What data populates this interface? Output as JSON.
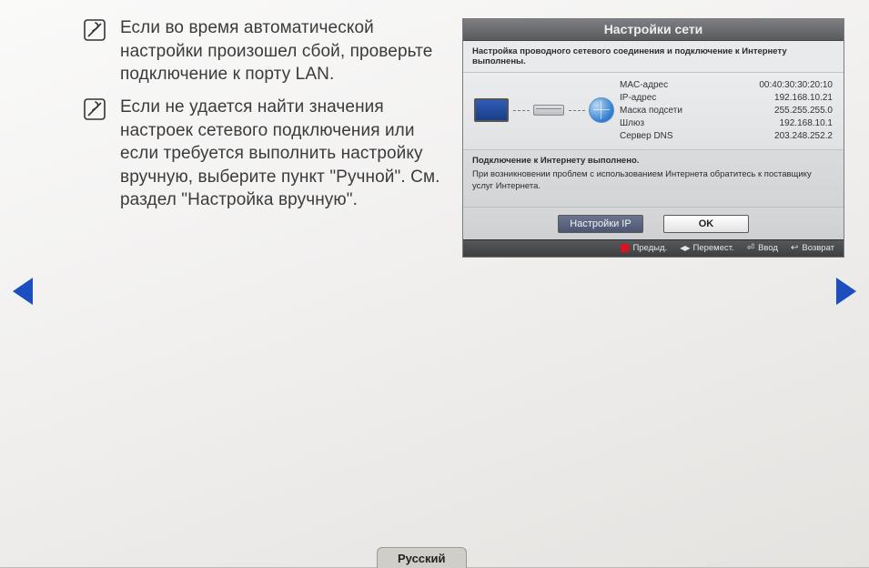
{
  "notes": [
    {
      "text": "Если во время автоматической настройки произошел сбой, проверьте подключение к порту LAN."
    },
    {
      "text": "Если не удается найти значения настроек сетевого подключения или если требуется выполнить настройку вручную, выберите пункт \"Ручной\". См. раздел \"Настройка вручную\"."
    }
  ],
  "panel": {
    "title": "Настройки сети",
    "status": "Настройка проводного сетевого соединения и подключение к Интернету выполнены.",
    "rows": [
      {
        "label": "MAC-адрес",
        "value": "00:40:30:30:20:10"
      },
      {
        "label": "IP-адрес",
        "value": "192.168.10.21"
      },
      {
        "label": "Маска подсети",
        "value": "255.255.255.0"
      },
      {
        "label": "Шлюз",
        "value": "192.168.10.1"
      },
      {
        "label": "Сервер DNS",
        "value": "203.248.252.2"
      }
    ],
    "msg_ok": "Подключение к Интернету выполнено.",
    "msg_help": "При возникновении проблем с использованием Интернета обратитесь к поставщику услуг Интернета.",
    "btn_ip": "Настройки IP",
    "btn_ok": "OK",
    "footer": {
      "prev": "Предыд.",
      "move": "Перемест.",
      "enter": "Ввод",
      "return": "Возврат"
    }
  },
  "language": "Русский"
}
